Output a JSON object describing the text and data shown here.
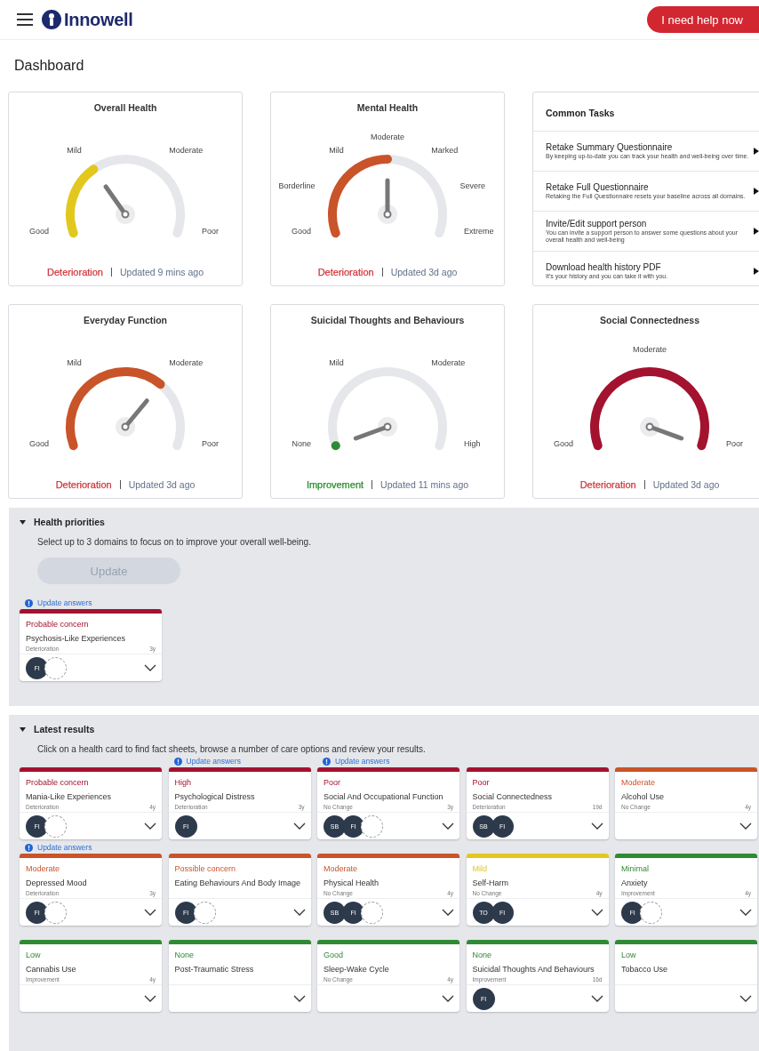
{
  "header": {
    "logo_text": "Innowell",
    "help_button": "I need help now"
  },
  "page_title": "Dashboard",
  "gauges": [
    {
      "title": "Overall Health",
      "labels": [
        "Good",
        "Mild",
        "Moderate",
        "Poor"
      ],
      "color": "#e2c81e",
      "trend": {
        "text": "Deterioration",
        "color": "#d0363c"
      },
      "updated": "Updated 9 mins ago"
    },
    {
      "title": "Mental Health",
      "labels": [
        "Good",
        "Borderline",
        "Mild",
        "Moderate",
        "Marked",
        "Severe",
        "Extreme"
      ],
      "color": "#c9542a",
      "trend": {
        "text": "Deterioration",
        "color": "#d0363c"
      },
      "updated": "Updated 3d ago"
    },
    {
      "title": "Everyday Function",
      "labels": [
        "Good",
        "Mild",
        "Moderate",
        "Poor"
      ],
      "color": "#c9542a",
      "trend": {
        "text": "Deterioration",
        "color": "#d0363c"
      },
      "updated": "Updated 3d ago"
    },
    {
      "title": "Suicidal Thoughts and Behaviours",
      "labels": [
        "None",
        "Mild",
        "Moderate",
        "High"
      ],
      "color": "#2f8a34",
      "trend": {
        "text": "Improvement",
        "color": "#2a8a2a"
      },
      "updated": "Updated 11 mins ago"
    },
    {
      "title": "Social Connectedness",
      "labels": [
        "Good",
        "Moderate",
        "Poor"
      ],
      "color": "#a3122f",
      "trend": {
        "text": "Deterioration",
        "color": "#d0363c"
      },
      "updated": "Updated 3d ago"
    }
  ],
  "common_tasks": {
    "title": "Common Tasks",
    "items": [
      {
        "title": "Retake Summary Questionnaire",
        "description": "By keeping up-to-date you can track your health and well-being over time."
      },
      {
        "title": "Retake Full Questionnaire",
        "description": "Retaking the Full Questionnaire resets your baseline across all domains."
      },
      {
        "title": "Invite/Edit support person",
        "description": "You can invite a support person to answer some questions about your overall health and well-being"
      },
      {
        "title": "Download health history PDF",
        "description": "It's your history and you can take it with you."
      }
    ]
  },
  "health_priorities": {
    "title": "Health priorities",
    "expanded": true,
    "description": "Select up to 3 domains to focus on to improve your overall well-being.",
    "update_button": {
      "label": "Update",
      "disabled": true
    },
    "cards": [
      {
        "update_answers": "Update answers",
        "color": "#a3122f",
        "severity": "Probable concern",
        "name": "Psychosis-Like Experiences",
        "trend": "Deterioration",
        "age": "3y",
        "avatars": [
          "FI"
        ],
        "pending": true
      }
    ]
  },
  "latest_results": {
    "title": "Latest results",
    "expanded": true,
    "description": "Click on a health card to find fact sheets, browse a number of care options and review your results.",
    "cards": [
      {
        "color": "#a3122f",
        "severity": "Probable concern",
        "name": "Mania-Like Experiences",
        "trend": "Deterioration",
        "age": "4y",
        "avatars": [
          "FI"
        ],
        "pending": true
      },
      {
        "update_answers": "Update answers",
        "color": "#a3122f",
        "severity": "High",
        "name": "Psychological Distress",
        "trend": "Deterioration",
        "age": "3y",
        "avatars": [
          "FI"
        ],
        "pending": false
      },
      {
        "update_answers": "Update answers",
        "color": "#a3122f",
        "severity": "Poor",
        "name": "Social And Occupational Function",
        "trend": "No Change",
        "age": "3y",
        "avatars": [
          "SB",
          "FI"
        ],
        "pending": true
      },
      {
        "color": "#a3122f",
        "severity": "Poor",
        "name": "Social Connectedness",
        "trend": "Deterioration",
        "age": "19d",
        "avatars": [
          "SB",
          "FI"
        ],
        "pending": false
      },
      {
        "color": "#c9542a",
        "severity": "Moderate",
        "name": "Alcohol Use",
        "trend": "No Change",
        "age": "4y",
        "pending": false
      },
      {
        "update_answers": "Update answers",
        "color": "#c9542a",
        "severity": "Moderate",
        "name": "Depressed Mood",
        "trend": "Deterioration",
        "age": "3y",
        "avatars": [
          "FI"
        ],
        "pending": true
      },
      {
        "color": "#c9542a",
        "severity": "Possible concern",
        "name": "Eating Behaviours And Body Image",
        "avatars": [
          "FI"
        ],
        "pending": true
      },
      {
        "color": "#c9542a",
        "severity": "Moderate",
        "name": "Physical Health",
        "trend": "No Change",
        "age": "4y",
        "avatars": [
          "SB",
          "FI"
        ],
        "pending": true
      },
      {
        "color": "#e2c81e",
        "severity": "Mild",
        "name": "Self-Harm",
        "trend": "No Change",
        "age": "4y",
        "avatars": [
          "TO",
          "FI"
        ],
        "pending": false
      },
      {
        "color": "#2f8a34",
        "severity": "Minimal",
        "name": "Anxiety",
        "trend": "Improvement",
        "age": "4y",
        "avatars": [
          "FI"
        ],
        "pending": true
      },
      {
        "color": "#2f8a34",
        "severity": "Low",
        "name": "Cannabis Use",
        "trend": "Improvement",
        "age": "4y",
        "pending": false
      },
      {
        "color": "#2f8a34",
        "severity": "None",
        "name": "Post-Traumatic Stress",
        "pending": false
      },
      {
        "color": "#2f8a34",
        "severity": "Good",
        "name": "Sleep-Wake Cycle",
        "trend": "No Change",
        "age": "4y",
        "pending": false
      },
      {
        "color": "#2f8a34",
        "severity": "None",
        "name": "Suicidal Thoughts And Behaviours",
        "trend": "Improvement",
        "age": "16d",
        "avatars": [
          "FI"
        ],
        "pending": false
      },
      {
        "color": "#2f8a34",
        "severity": "Low",
        "name": "Tobacco Use",
        "pending": false
      }
    ]
  }
}
